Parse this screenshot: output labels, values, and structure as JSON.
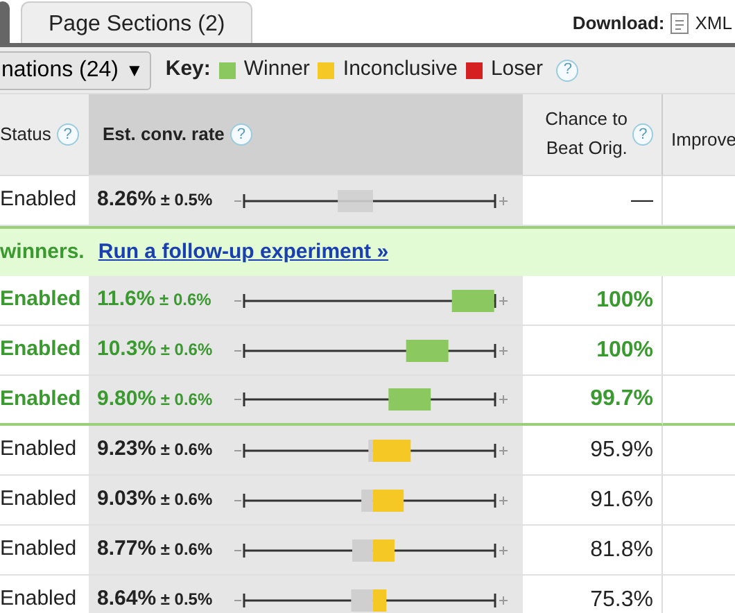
{
  "tabs": [
    {
      "selected": true
    },
    {
      "label": "Page Sections (2)",
      "selected": false
    }
  ],
  "download": {
    "label": "Download:",
    "link": "XML"
  },
  "toolbar": {
    "dropdown": "nations (24)",
    "caret": "▼",
    "key_label": "Key:",
    "help": "?"
  },
  "legend": [
    {
      "label": "Winner",
      "color": "#8cc860"
    },
    {
      "label": "Inconclusive",
      "color": "#f5c825"
    },
    {
      "label": "Loser",
      "color": "#d42020"
    }
  ],
  "columns": [
    {
      "label": "Status",
      "help": "?"
    },
    {
      "label": "Est. conv. rate",
      "help": "?"
    },
    {
      "label": "Chance to Beat Orig.",
      "help": "?"
    },
    {
      "label": "Improve"
    }
  ],
  "rows": [
    {
      "kind": "original",
      "status": "Enabled",
      "rate": "8.26%",
      "margin": "± 0.5%",
      "chance": "—"
    },
    {
      "kind": "banner",
      "text": "winners.",
      "link": "Run a follow-up experiment »"
    },
    {
      "kind": "winner",
      "status": "Enabled",
      "rate": "11.6%",
      "margin": "± 0.6%",
      "chance": "100%"
    },
    {
      "kind": "winner",
      "status": "Enabled",
      "rate": "10.3%",
      "margin": "± 0.6%",
      "chance": "100%"
    },
    {
      "kind": "winner",
      "status": "Enabled",
      "rate": "9.80%",
      "margin": "± 0.6%",
      "chance": "99.7%"
    },
    {
      "kind": "inconclusive",
      "status": "Enabled",
      "rate": "9.23%",
      "margin": "± 0.6%",
      "chance": "95.9%"
    },
    {
      "kind": "inconclusive",
      "status": "Enabled",
      "rate": "9.03%",
      "margin": "± 0.6%",
      "chance": "91.6%"
    },
    {
      "kind": "inconclusive",
      "status": "Enabled",
      "rate": "8.77%",
      "margin": "± 0.6%",
      "chance": "81.8%"
    },
    {
      "kind": "inconclusive",
      "status": "Enabled",
      "rate": "8.64%",
      "margin": "± 0.5%",
      "chance": "75.3%"
    }
  ]
}
